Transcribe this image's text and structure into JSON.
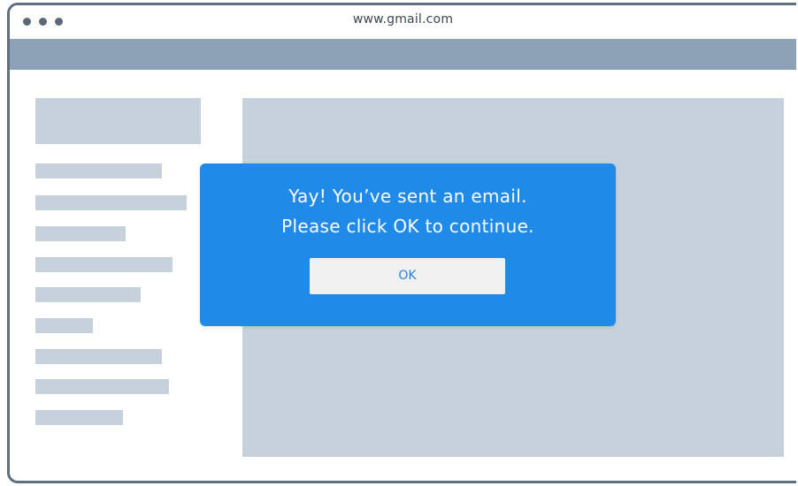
{
  "browser": {
    "url": "www.gmail.com",
    "window_control_icons": [
      "dot-icon",
      "dot-icon",
      "dot-icon"
    ]
  },
  "dialog": {
    "message_line1": "Yay! You’ve sent an email.",
    "message_line2": "Please click OK to continue.",
    "ok_label": "OK"
  },
  "colors": {
    "window_border": "#5f6f80",
    "toolbar": "#8ea2b7",
    "placeholder": "#c7d1db",
    "dialog_background": "#1f8ae8",
    "dialog_text": "#ffffff",
    "button_background": "#f0f0f0",
    "button_text": "#2a83d8"
  }
}
